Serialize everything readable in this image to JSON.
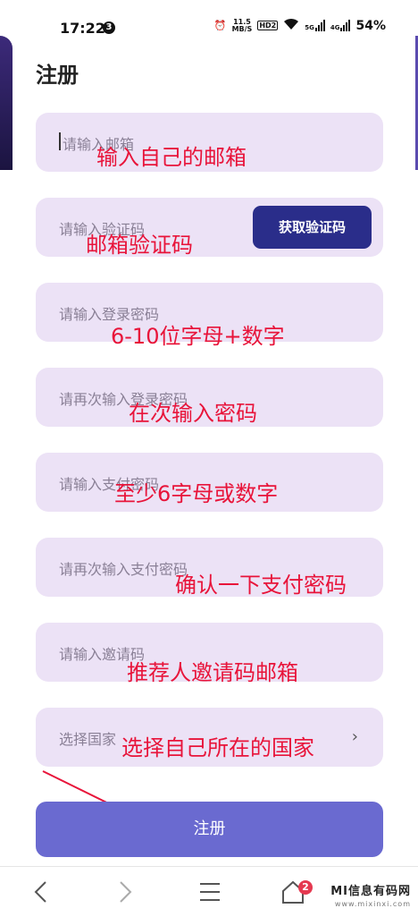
{
  "status_bar": {
    "time": "17:22",
    "notification_count": "3",
    "net_speed_top": "11.5",
    "net_speed_bottom": "MB/S",
    "hd_label": "HD2",
    "sig1_label": "5G",
    "sig2_label": "4G",
    "battery": "54%"
  },
  "page": {
    "title": "注册"
  },
  "form": {
    "email_placeholder": "请输入邮箱",
    "code_placeholder": "请输入验证码",
    "get_code_label": "获取验证码",
    "login_password_placeholder": "请输入登录密码",
    "confirm_login_password_placeholder": "请再次输入登录密码",
    "pay_password_placeholder": "请输入支付密码",
    "confirm_pay_password_placeholder": "请再次输入支付密码",
    "invite_code_placeholder": "请输入邀请码",
    "country_placeholder": "选择国家",
    "submit_label": "注册"
  },
  "annotations": {
    "email": "输入自己的邮箱",
    "code": "邮箱验证码",
    "login_password": "6-10位字母+数字",
    "confirm_login_password": "在次输入密码",
    "pay_password": "至少6字母或数字",
    "confirm_pay_password": "确认一下支付密码",
    "invite_code": "推荐人邀请码邮箱",
    "country": "选择自己所在的国家"
  },
  "colors": {
    "field_bg": "#ece2f6",
    "accent_button": "#2a2d8a",
    "submit_button": "#6a6ad0",
    "annotation": "#e8143a"
  },
  "bottom_nav": {
    "home_badge": "2",
    "watermark_main": "MI信息有码网",
    "watermark_sub": "www.mixinxi.com"
  },
  "icons": [
    "back-icon",
    "forward-icon",
    "menu-icon",
    "home-icon",
    "chevron-right-icon",
    "alarm-icon",
    "wifi-icon"
  ]
}
